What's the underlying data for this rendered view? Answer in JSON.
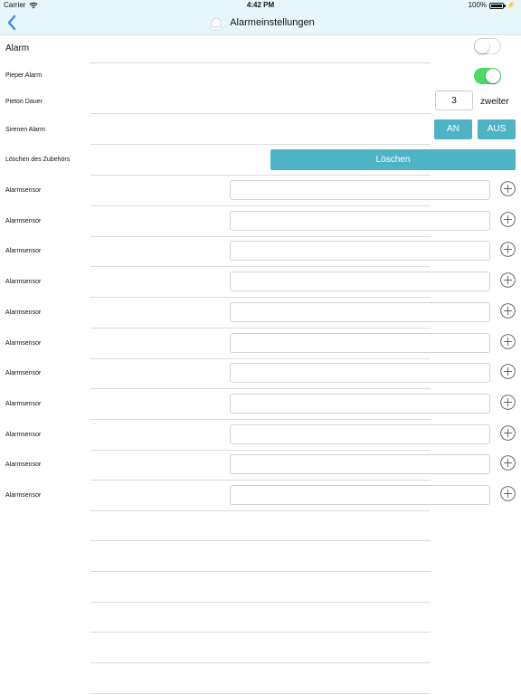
{
  "status_bar": {
    "carrier": "Carrier",
    "time": "4:42 PM",
    "battery": "100%",
    "battery_level": 1.0,
    "wifi_icon": "wifi-icon",
    "battery_icon": "battery-icon"
  },
  "nav": {
    "title": "Alarmeinstellungen",
    "back_icon": "chevron-left-icon",
    "title_icon": "siren-icon"
  },
  "settings": {
    "alarm_label": "Alarm",
    "alarm_on": false,
    "pieper_label": "Pieper Alarm",
    "pieper_on": true,
    "pieton_label": "Pieton Dauer",
    "pieton_value": "3",
    "pieton_unit": "zweiter",
    "siren_label": "Sirenen Alarm",
    "siren_on_label": "AN",
    "siren_off_label": "AUS",
    "delete_label": "Löschen des Zubehörs",
    "delete_button": "Löschen"
  },
  "sensors": [
    {
      "label": "Alarmsensor",
      "value": ""
    },
    {
      "label": "Alarmsensor",
      "value": ""
    },
    {
      "label": "Alarmsensor",
      "value": ""
    },
    {
      "label": "Alarmsensor",
      "value": ""
    },
    {
      "label": "Alarmsensor",
      "value": ""
    },
    {
      "label": "Alarmsensor",
      "value": ""
    },
    {
      "label": "Alarmsensor",
      "value": ""
    },
    {
      "label": "Alarmsensor",
      "value": ""
    },
    {
      "label": "Alarmsensor",
      "value": ""
    },
    {
      "label": "Alarmsensor",
      "value": ""
    },
    {
      "label": "Alarmsensor",
      "value": ""
    }
  ],
  "colors": {
    "accent": "#4fb3c6",
    "toggle_on": "#4cd964",
    "nav_background": "#e6f6fb",
    "back_arrow": "#3a8de0"
  }
}
